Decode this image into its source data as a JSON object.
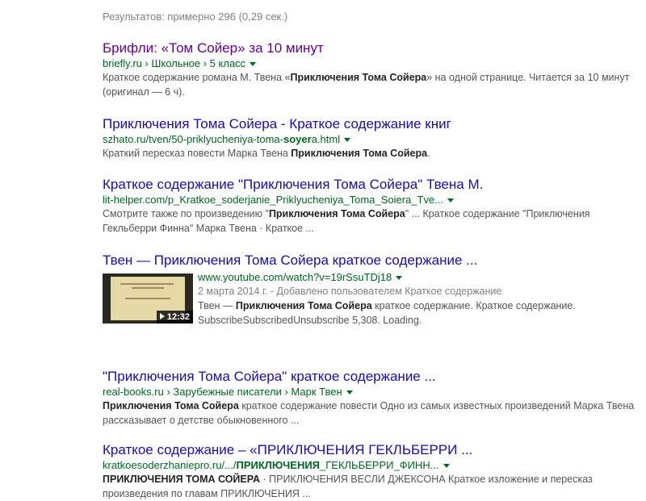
{
  "stats": "Результатов: примерно 296 (0,29 сек.)",
  "results": [
    {
      "title": "Брифли: «Том Сойер» за 10 минут",
      "visited": true,
      "url_parts": [
        "briefly.ru",
        " › Школьное › 5 класс"
      ],
      "snippet": [
        {
          "t": "Краткое содержание романа М. Твена «"
        },
        {
          "t": "Приключения Тома Сойера",
          "b": true
        },
        {
          "t": "» на одной странице. Читается за 10 минут (оригинал — 6 ч)."
        }
      ]
    },
    {
      "title": "Приключения Тома Сойера - Краткое содержание книг",
      "url_parts": [
        "szhato.ru/tven/50-priklyucheniya-toma-",
        "soyer",
        "a.html"
      ],
      "snippet": [
        {
          "t": "Краткий пересказ повести Марка Твена "
        },
        {
          "t": "Приключения Тома Сойера",
          "b": true
        },
        {
          "t": "."
        }
      ]
    },
    {
      "title": "Краткое содержание \"Приключения Тома Сойера\" Твена М.",
      "url_parts": [
        "lit-helper.com/p_Kratkoe_soderjanie_Priklyucheniya_Toma_Soiera_Tve..."
      ],
      "snippet": [
        {
          "t": "Смотрите также по произведению \""
        },
        {
          "t": "Приключения Тома Сойера",
          "b": true
        },
        {
          "t": "\" ... Краткое содержание \"Приключения Гекльберри Финна\" Марка Твена · Краткое ..."
        }
      ]
    },
    {
      "title": "Твен — Приключения Тома Сойера краткое содержание ...",
      "url": "www.youtube.com/watch?v=19rSsuTDj18",
      "meta": "2 марта 2014 г. - Добавлено пользователем Краткое содержание",
      "duration": "12:32",
      "snippet": [
        {
          "t": "Твен — "
        },
        {
          "t": "Приключения Тома Сойера",
          "b": true
        },
        {
          "t": " краткое содержание. Краткое содержание. SubscribeSubscribedUnsubscribe 5,308. Loading."
        }
      ]
    },
    {
      "title": "\"Приключения Тома Сойера\" краткое содержание ...",
      "url_parts": [
        "real-books.ru",
        " › Зарубежные писатели › Марк Твен"
      ],
      "snippet": [
        {
          "t": "Приключения Тома Сойера",
          "b": true
        },
        {
          "t": " краткое содержание повести Одно из самых известных произведений Марка Твена рассказывает о детстве обыкновенного ..."
        }
      ]
    },
    {
      "title": "Краткое содержание – «ПРИКЛЮЧЕНИЯ ГЕКЛЬБЕРРИ ...",
      "url_parts": [
        "kratkoesoderzhanieprо.ru/.../",
        "ПРИКЛЮЧЕНИЯ",
        "_ГЕКЛЬБЕРРИ_ФИНН..."
      ],
      "snippet": [
        {
          "t": "ПРИКЛЮЧЕНИЯ ТОМА СОЙЕРА",
          "b": true
        },
        {
          "t": " · ПРИКЛЮЧЕНИЯ ВЕСЛИ ДЖЕКСОНА Краткое изложение и пересказ произведения по главам ПРИКЛЮЧЕНИЯ ..."
        }
      ]
    }
  ],
  "colors": {
    "title_link": "#1a0dab",
    "title_visited": "#660099",
    "url_green": "#006621",
    "snippet_gray": "#545454"
  },
  "icons": {
    "url_menu": "caret-down-icon",
    "video_play": "play-icon"
  }
}
